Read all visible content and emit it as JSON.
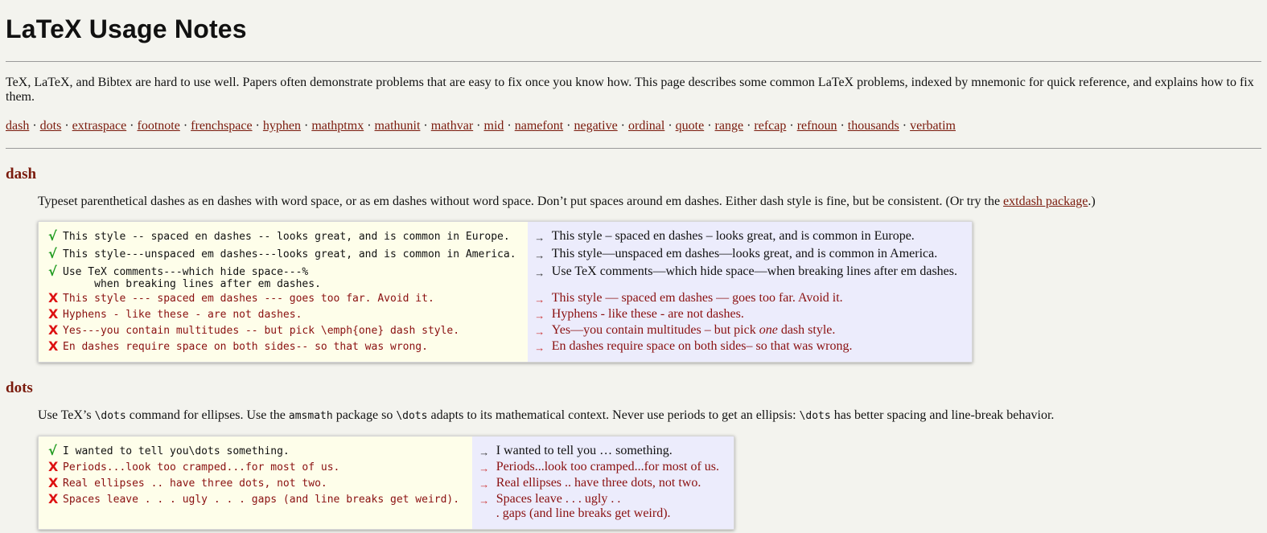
{
  "page": {
    "title": "LaTeX Usage Notes",
    "intro": "TeX, LaTeX, and Bibtex are hard to use well. Papers often demonstrate problems that are easy to fix once you know how. This page describes some common LaTeX problems, indexed by mnemonic for quick reference, and explains how to fix them.",
    "nav": [
      "dash",
      "dots",
      "extraspace",
      "footnote",
      "frenchspace",
      "hyphen",
      "mathptmx",
      "mathunit",
      "mathvar",
      "mid",
      "namefont",
      "negative",
      "ordinal",
      "quote",
      "range",
      "refcap",
      "refnoun",
      "thousands",
      "verbatim"
    ],
    "nav_separator": " · "
  },
  "colors": {
    "link": "#7a1a0c",
    "ok": "#1e9a1e",
    "bad": "#d11111",
    "source_bg": "#fefeea",
    "output_bg": "#ececfc"
  },
  "dash": {
    "heading": "dash",
    "desc_before": "Typeset parenthetical dashes as en dashes with word space, or as em dashes without word space. Don’t put spaces around em dashes. Either dash style is fine, but be consistent. (Or try the ",
    "desc_link": "extdash package",
    "desc_after": ".)",
    "arrow": "→",
    "rows": [
      {
        "mark": "√",
        "good": true,
        "src": "This style -- spaced en dashes -- looks great, and is common in Europe.",
        "out": "This style – spaced en dashes – looks great, and is common in Europe."
      },
      {
        "mark": "√",
        "good": true,
        "src": "This style---unspaced em dashes---looks great, and is common in America.",
        "out": "This style—unspaced em dashes—looks great, and is common in America."
      },
      {
        "mark": "√",
        "good": true,
        "src": "Use TeX comments---which hide space---%\n     when breaking lines after em dashes.",
        "out": "Use TeX comments—which hide space—when breaking lines after em dashes."
      },
      {
        "mark": "X",
        "good": false,
        "src": "This style --- spaced em dashes --- goes too far. Avoid it.",
        "out": "This style — spaced em dashes — goes too far. Avoid it."
      },
      {
        "mark": "X",
        "good": false,
        "src": "Hyphens - like these - are not dashes.",
        "out": "Hyphens - like these - are not dashes."
      },
      {
        "mark": "X",
        "good": false,
        "src": "Yes---you contain multitudes -- but pick \\emph{one} dash style.",
        "out_before": "Yes—you contain multitudes – but pick ",
        "out_em": "one",
        "out_after": " dash style."
      },
      {
        "mark": "X",
        "good": false,
        "src": "En dashes require space on both sides-- so that was wrong.",
        "out": "En dashes require space on both sides– so that was wrong."
      }
    ]
  },
  "dots": {
    "heading": "dots",
    "desc_1": "Use TeX’s ",
    "desc_code1": "\\dots",
    "desc_2": " command for ellipses. Use the ",
    "desc_code2": "amsmath",
    "desc_3": " package so ",
    "desc_code3": "\\dots",
    "desc_4": " adapts to its mathematical context. Never use periods to get an ellipsis: ",
    "desc_code4": "\\dots",
    "desc_5": " has better spacing and line-break behavior.",
    "arrow": "→",
    "rows": [
      {
        "mark": "√",
        "good": true,
        "src": "I wanted to tell you\\dots something.",
        "out": "I wanted to tell you … something."
      },
      {
        "mark": "X",
        "good": false,
        "src": "Periods...look too cramped...for most of us.",
        "out": "Periods...look too cramped...for most of us."
      },
      {
        "mark": "X",
        "good": false,
        "src": "Real ellipses .. have three dots, not two.",
        "out": "Real ellipses .. have three dots, not two."
      },
      {
        "mark": "X",
        "good": false,
        "src": "Spaces leave . . . ugly . . . gaps (and line breaks get weird).",
        "out": "Spaces leave . . . ugly . .\n. gaps (and line breaks get weird)."
      }
    ]
  }
}
